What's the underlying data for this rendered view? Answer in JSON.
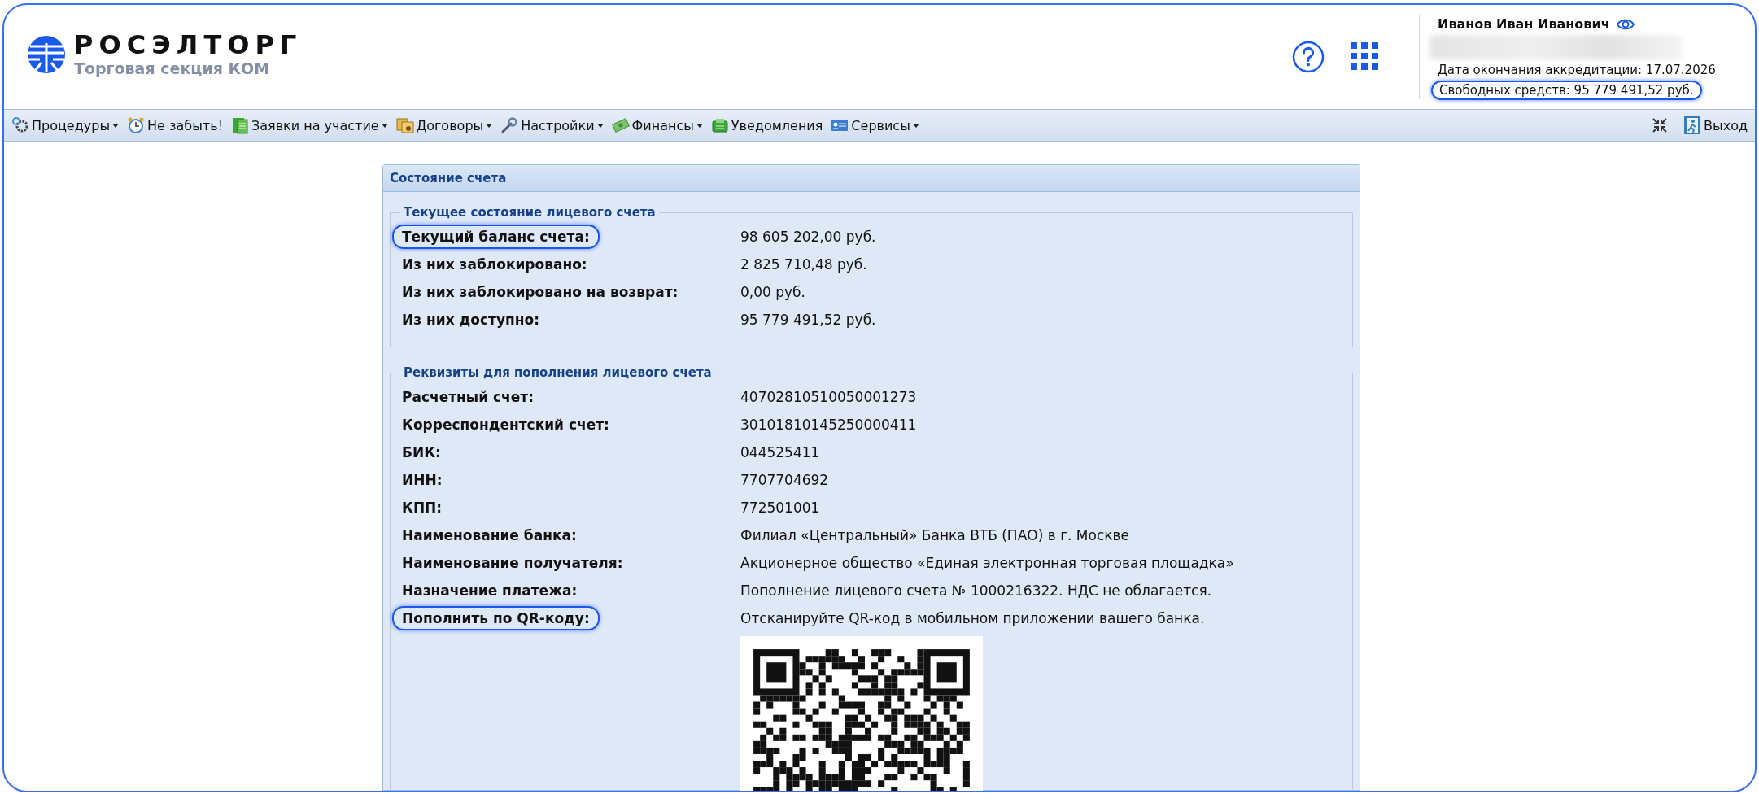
{
  "header": {
    "logo": {
      "name": "РОСЭЛТОРГ",
      "subtitle": "Торговая секция КОМ"
    },
    "user": {
      "name": "Иванов Иван Иванович",
      "accreditation": "Дата окончания аккредитации: 17.07.2026",
      "free_funds": {
        "text": "Свободных средств: 95 779 491,52 руб.",
        "highlighted": true
      }
    }
  },
  "menu": [
    {
      "label": "Процедуры",
      "dropdown": true
    },
    {
      "label": "Не забыть!",
      "dropdown": false
    },
    {
      "label": "Заявки на участие",
      "dropdown": true
    },
    {
      "label": "Договоры",
      "dropdown": true
    },
    {
      "label": "Настройки",
      "dropdown": true
    },
    {
      "label": "Финансы",
      "dropdown": true
    },
    {
      "label": "Уведомления",
      "dropdown": false
    },
    {
      "label": "Сервисы",
      "dropdown": true
    }
  ],
  "exit": "Выход",
  "panel": {
    "title": "Состояние счета",
    "sections": [
      {
        "legend": "Текущее состояние лицевого счета",
        "rows": [
          {
            "label": "Текущий баланс счета:",
            "value": "98 605 202,00 руб.",
            "highlighted": true,
            "qr_code": false
          },
          {
            "label": "Из них заблокировано:",
            "value": "2 825 710,48 руб.",
            "highlighted": false,
            "qr_code": false
          },
          {
            "label": "Из них заблокировано на возврат:",
            "value": "0,00 руб.",
            "highlighted": false,
            "qr_code": false
          },
          {
            "label": "Из них доступно:",
            "value": "95 779 491,52 руб.",
            "highlighted": false,
            "qr_code": false
          }
        ]
      },
      {
        "legend": "Реквизиты для пополнения лицевого счета",
        "rows": [
          {
            "label": "Расчетный счет:",
            "value": "40702810510050001273",
            "highlighted": false,
            "qr_code": false
          },
          {
            "label": "Корреспондентский счет:",
            "value": "30101810145250000411",
            "highlighted": false,
            "qr_code": false
          },
          {
            "label": "БИК:",
            "value": "044525411",
            "highlighted": false,
            "qr_code": false
          },
          {
            "label": "ИНН:",
            "value": "7707704692",
            "highlighted": false,
            "qr_code": false
          },
          {
            "label": "КПП:",
            "value": "772501001",
            "highlighted": false,
            "qr_code": false
          },
          {
            "label": "Наименование банка:",
            "value": "Филиал «Центральный» Банка ВТБ (ПАО) в г. Москве",
            "highlighted": false,
            "qr_code": false
          },
          {
            "label": "Наименование получателя:",
            "value": "Акционерное общество «Единая электронная торговая площадка»",
            "highlighted": false,
            "qr_code": false
          },
          {
            "label": "Назначение платежа:",
            "value": "Пополнение лицевого счета № 1000216322. НДС не облагается.",
            "highlighted": false,
            "qr_code": false
          },
          {
            "label": "Пополнить по QR-коду:",
            "value": "Отсканируйте QR-код в мобильном приложении вашего банка.",
            "highlighted": true,
            "qr_code": true
          }
        ]
      }
    ]
  }
}
